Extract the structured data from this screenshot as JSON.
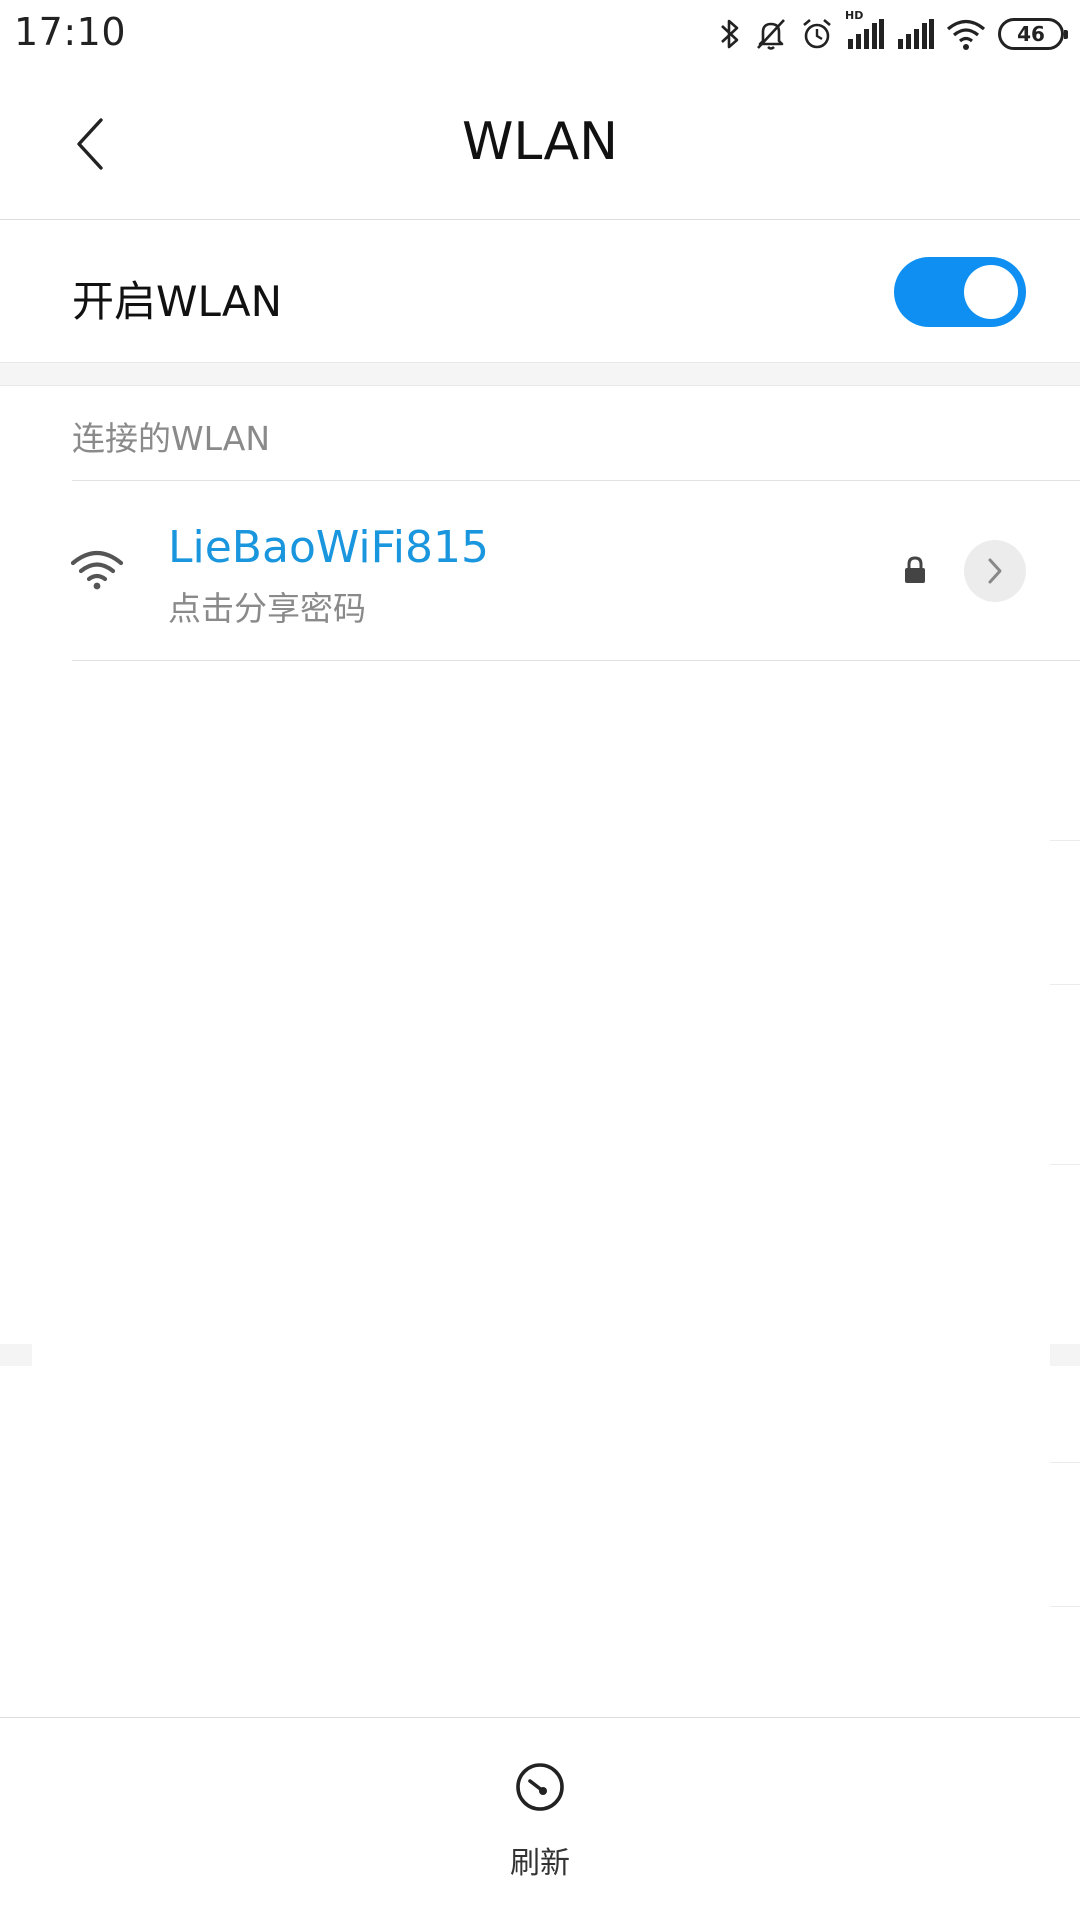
{
  "status_bar": {
    "time": "17:10",
    "icons": [
      "bluetooth-icon",
      "mute-icon",
      "alarm-icon",
      "hd-signal-icon",
      "signal-icon",
      "wifi-status-icon"
    ],
    "hd_label": "HD",
    "battery_level": "46"
  },
  "header": {
    "title": "WLAN",
    "back_icon": "chevron-left-icon"
  },
  "wlan_toggle": {
    "label": "开启WLAN",
    "enabled": true,
    "accent_color": "#0e8ff1"
  },
  "connected_section": {
    "header": "连接的WLAN",
    "networks": [
      {
        "name": "LieBaoWiFi815",
        "subtitle": "点击分享密码",
        "secured": true,
        "name_color": "#1a96de"
      }
    ]
  },
  "bottom_bar": {
    "refresh_label": "刷新",
    "refresh_icon": "refresh-icon"
  }
}
